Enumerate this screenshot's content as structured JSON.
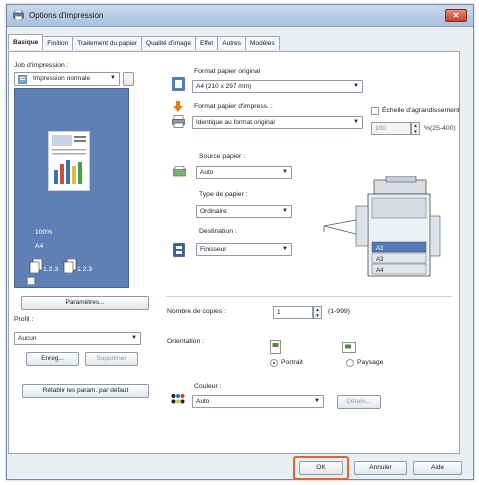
{
  "window": {
    "title": "Options d'impression"
  },
  "tabs": [
    "Basique",
    "Finition",
    "Traitement du papier",
    "Qualité d'image",
    "Effet",
    "Autres",
    "Modèles"
  ],
  "left": {
    "job_label": "Job d'impression :",
    "job_value": "Impression normale",
    "zoom": "100%",
    "paper_size": "A4",
    "collate1": "1.2.3",
    "collate2": "1.2.3",
    "params_button": "Paramètres...",
    "profile_label": "Profil :",
    "profile_value": "Aucun",
    "save_button": "Enreg...",
    "delete_button": "Supprimer",
    "restore_button": "Rétablir les param. par défaut"
  },
  "right": {
    "orig_paper_label": "Format papier original",
    "orig_paper_value": "A4 (210 x 297 mm)",
    "print_paper_label": "Format papier d'impress. :",
    "print_paper_value": "Identique au format original",
    "scale_label": "Échelle d'agrandissement",
    "scale_value": "100",
    "scale_range": "%(25-400)",
    "source_label": "Source papier :",
    "source_value": "Auto",
    "type_label": "Type de papier :",
    "type_value": "Ordinaire",
    "dest_label": "Destination :",
    "dest_value": "Finisseur",
    "tray_labels": [
      "A3",
      "A3",
      "A4"
    ],
    "copies_label": "Nombre de copies :",
    "copies_value": "1",
    "copies_range": "(1-999)",
    "orientation_label": "Orientation :",
    "portrait": "Portrait",
    "landscape": "Paysage",
    "color_label": "Couleur :",
    "color_value": "Auto",
    "details_button": "Détails..."
  },
  "footer": {
    "ok": "OK",
    "cancel": "Annuler",
    "help": "Aide"
  },
  "colors": {
    "highlight": "#e2632b",
    "preview_bg": "#5f7fb5",
    "title_gradient_top": "#c9d9ee"
  }
}
